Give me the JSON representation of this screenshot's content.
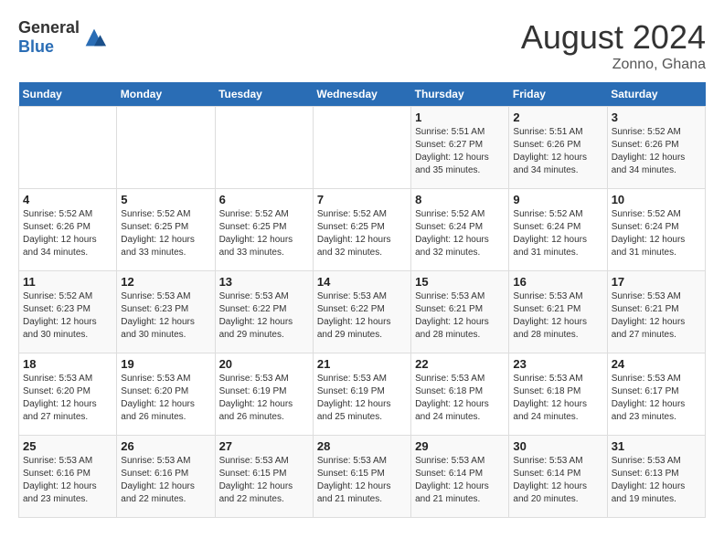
{
  "header": {
    "logo_general": "General",
    "logo_blue": "Blue",
    "month_title": "August 2024",
    "location": "Zonno, Ghana"
  },
  "weekdays": [
    "Sunday",
    "Monday",
    "Tuesday",
    "Wednesday",
    "Thursday",
    "Friday",
    "Saturday"
  ],
  "weeks": [
    [
      {
        "day": "",
        "info": ""
      },
      {
        "day": "",
        "info": ""
      },
      {
        "day": "",
        "info": ""
      },
      {
        "day": "",
        "info": ""
      },
      {
        "day": "1",
        "info": "Sunrise: 5:51 AM\nSunset: 6:27 PM\nDaylight: 12 hours and 35 minutes."
      },
      {
        "day": "2",
        "info": "Sunrise: 5:51 AM\nSunset: 6:26 PM\nDaylight: 12 hours and 34 minutes."
      },
      {
        "day": "3",
        "info": "Sunrise: 5:52 AM\nSunset: 6:26 PM\nDaylight: 12 hours and 34 minutes."
      }
    ],
    [
      {
        "day": "4",
        "info": "Sunrise: 5:52 AM\nSunset: 6:26 PM\nDaylight: 12 hours and 34 minutes."
      },
      {
        "day": "5",
        "info": "Sunrise: 5:52 AM\nSunset: 6:25 PM\nDaylight: 12 hours and 33 minutes."
      },
      {
        "day": "6",
        "info": "Sunrise: 5:52 AM\nSunset: 6:25 PM\nDaylight: 12 hours and 33 minutes."
      },
      {
        "day": "7",
        "info": "Sunrise: 5:52 AM\nSunset: 6:25 PM\nDaylight: 12 hours and 32 minutes."
      },
      {
        "day": "8",
        "info": "Sunrise: 5:52 AM\nSunset: 6:24 PM\nDaylight: 12 hours and 32 minutes."
      },
      {
        "day": "9",
        "info": "Sunrise: 5:52 AM\nSunset: 6:24 PM\nDaylight: 12 hours and 31 minutes."
      },
      {
        "day": "10",
        "info": "Sunrise: 5:52 AM\nSunset: 6:24 PM\nDaylight: 12 hours and 31 minutes."
      }
    ],
    [
      {
        "day": "11",
        "info": "Sunrise: 5:52 AM\nSunset: 6:23 PM\nDaylight: 12 hours and 30 minutes."
      },
      {
        "day": "12",
        "info": "Sunrise: 5:53 AM\nSunset: 6:23 PM\nDaylight: 12 hours and 30 minutes."
      },
      {
        "day": "13",
        "info": "Sunrise: 5:53 AM\nSunset: 6:22 PM\nDaylight: 12 hours and 29 minutes."
      },
      {
        "day": "14",
        "info": "Sunrise: 5:53 AM\nSunset: 6:22 PM\nDaylight: 12 hours and 29 minutes."
      },
      {
        "day": "15",
        "info": "Sunrise: 5:53 AM\nSunset: 6:21 PM\nDaylight: 12 hours and 28 minutes."
      },
      {
        "day": "16",
        "info": "Sunrise: 5:53 AM\nSunset: 6:21 PM\nDaylight: 12 hours and 28 minutes."
      },
      {
        "day": "17",
        "info": "Sunrise: 5:53 AM\nSunset: 6:21 PM\nDaylight: 12 hours and 27 minutes."
      }
    ],
    [
      {
        "day": "18",
        "info": "Sunrise: 5:53 AM\nSunset: 6:20 PM\nDaylight: 12 hours and 27 minutes."
      },
      {
        "day": "19",
        "info": "Sunrise: 5:53 AM\nSunset: 6:20 PM\nDaylight: 12 hours and 26 minutes."
      },
      {
        "day": "20",
        "info": "Sunrise: 5:53 AM\nSunset: 6:19 PM\nDaylight: 12 hours and 26 minutes."
      },
      {
        "day": "21",
        "info": "Sunrise: 5:53 AM\nSunset: 6:19 PM\nDaylight: 12 hours and 25 minutes."
      },
      {
        "day": "22",
        "info": "Sunrise: 5:53 AM\nSunset: 6:18 PM\nDaylight: 12 hours and 24 minutes."
      },
      {
        "day": "23",
        "info": "Sunrise: 5:53 AM\nSunset: 6:18 PM\nDaylight: 12 hours and 24 minutes."
      },
      {
        "day": "24",
        "info": "Sunrise: 5:53 AM\nSunset: 6:17 PM\nDaylight: 12 hours and 23 minutes."
      }
    ],
    [
      {
        "day": "25",
        "info": "Sunrise: 5:53 AM\nSunset: 6:16 PM\nDaylight: 12 hours and 23 minutes."
      },
      {
        "day": "26",
        "info": "Sunrise: 5:53 AM\nSunset: 6:16 PM\nDaylight: 12 hours and 22 minutes."
      },
      {
        "day": "27",
        "info": "Sunrise: 5:53 AM\nSunset: 6:15 PM\nDaylight: 12 hours and 22 minutes."
      },
      {
        "day": "28",
        "info": "Sunrise: 5:53 AM\nSunset: 6:15 PM\nDaylight: 12 hours and 21 minutes."
      },
      {
        "day": "29",
        "info": "Sunrise: 5:53 AM\nSunset: 6:14 PM\nDaylight: 12 hours and 21 minutes."
      },
      {
        "day": "30",
        "info": "Sunrise: 5:53 AM\nSunset: 6:14 PM\nDaylight: 12 hours and 20 minutes."
      },
      {
        "day": "31",
        "info": "Sunrise: 5:53 AM\nSunset: 6:13 PM\nDaylight: 12 hours and 19 minutes."
      }
    ]
  ]
}
